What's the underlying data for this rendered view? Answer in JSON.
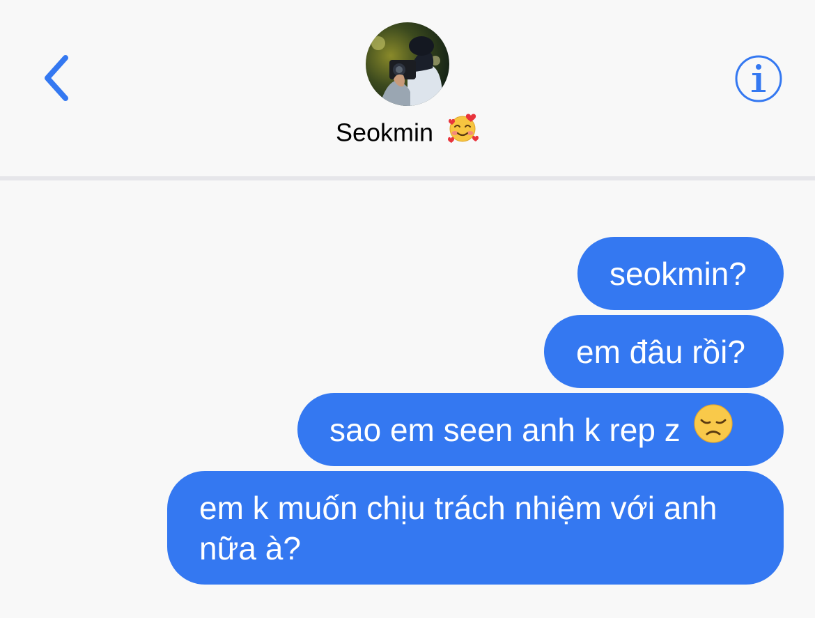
{
  "header": {
    "contact_name": "Seokmin",
    "name_emoji": "smiling-face-with-hearts-emoji",
    "back_icon": "chevron-left-icon",
    "info_icon": "info-circle-icon",
    "accent_color": "#3478f1"
  },
  "messages": [
    {
      "sender": "me",
      "text": "seokmin?"
    },
    {
      "sender": "me",
      "text": "em đâu rồi?"
    },
    {
      "sender": "me",
      "text": "sao em seen anh k rep z",
      "emoji": "disappointed-face-emoji"
    },
    {
      "sender": "me",
      "text": "em k muốn chịu trách nhiệm với anh nữa à?"
    }
  ],
  "colors": {
    "bubble": "#3478f1",
    "bubble_text": "#ffffff",
    "background": "#f8f8f8",
    "divider": "#e6e6ea"
  }
}
